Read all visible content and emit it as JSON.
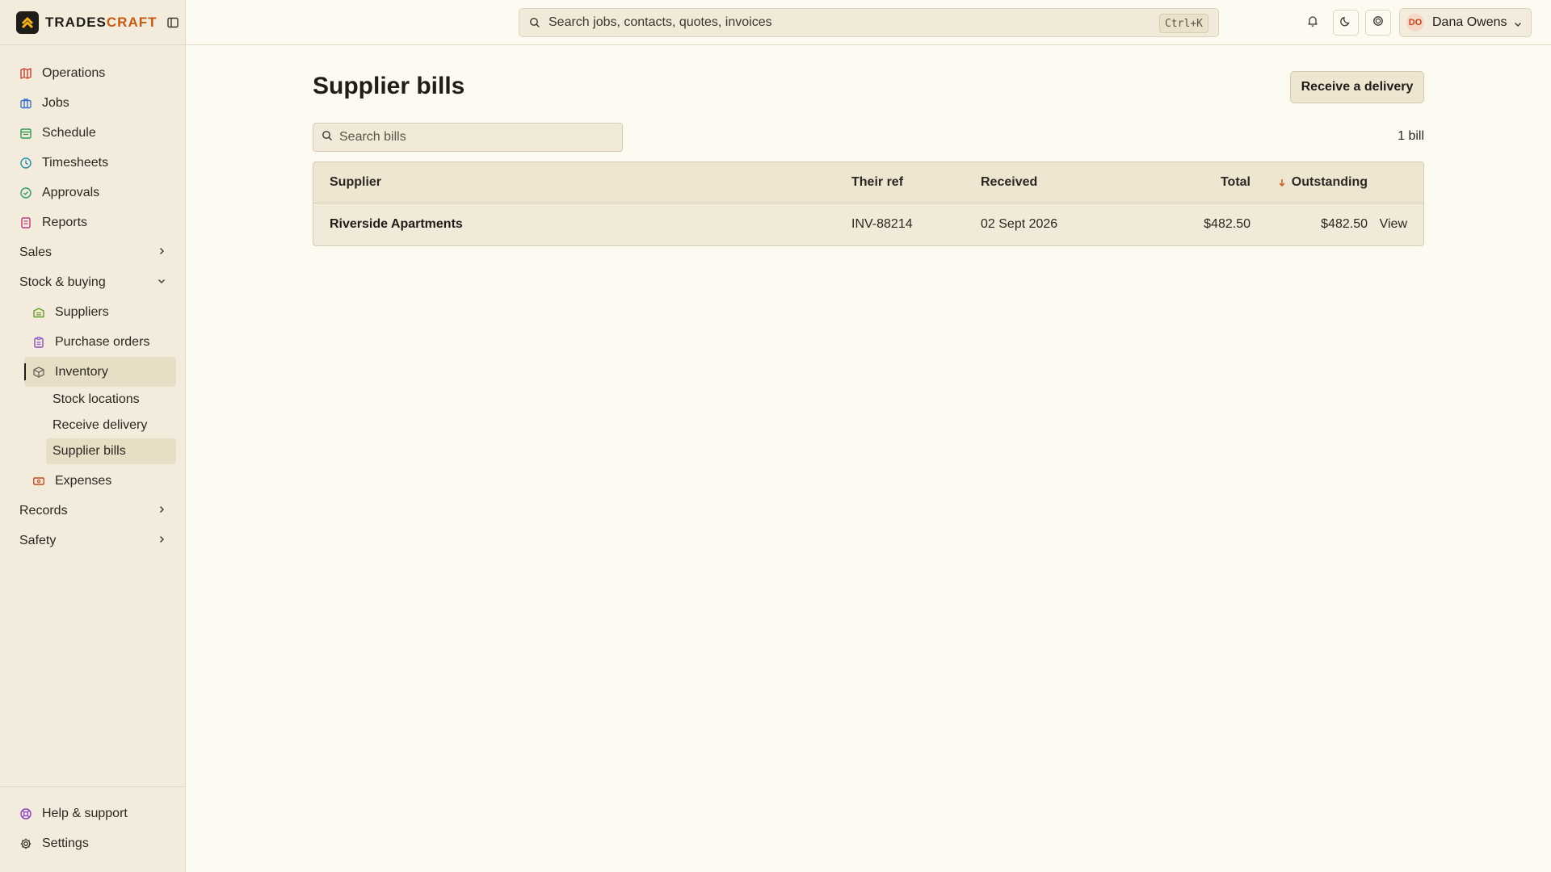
{
  "app": {
    "brand_prefix": "TRADES",
    "brand_suffix": "CRAFT"
  },
  "sidebar": {
    "items": [
      {
        "label": "Operations",
        "icon": "map-icon",
        "color": "#c8402c"
      },
      {
        "label": "Jobs",
        "icon": "briefcase-icon",
        "color": "#3a73c9"
      },
      {
        "label": "Schedule",
        "icon": "calendar-icon",
        "color": "#2f9a4c"
      },
      {
        "label": "Timesheets",
        "icon": "clock-icon",
        "color": "#1f8fa8"
      },
      {
        "label": "Approvals",
        "icon": "check-circle-icon",
        "color": "#2a9a6a"
      },
      {
        "label": "Reports",
        "icon": "report-icon",
        "color": "#c03a7a"
      }
    ],
    "groups": {
      "sales": "Sales",
      "stock": "Stock & buying",
      "records": "Records",
      "safety": "Safety"
    },
    "stock_items": [
      {
        "label": "Suppliers",
        "icon": "warehouse-icon",
        "color": "#6a9a2a"
      },
      {
        "label": "Purchase orders",
        "icon": "clipboard-icon",
        "color": "#8a4ac8"
      },
      {
        "label": "Inventory",
        "icon": "box-icon",
        "color": "#6b655a"
      }
    ],
    "inventory_sub": [
      "Stock locations",
      "Receive delivery",
      "Supplier bills"
    ],
    "expenses": {
      "label": "Expenses",
      "icon": "ticket-icon",
      "color": "#c44a22"
    },
    "bottom": [
      {
        "label": "Help & support",
        "icon": "lifebuoy-icon",
        "color": "#8a3ac0"
      },
      {
        "label": "Settings",
        "icon": "gear-icon",
        "color": "#3a362e"
      }
    ]
  },
  "topbar": {
    "search_placeholder": "Search jobs, contacts, quotes, invoices",
    "shortcut": "Ctrl+K",
    "user_initials": "DO",
    "user_name": "Dana Owens"
  },
  "main": {
    "title": "Supplier bills",
    "primary_action": "Receive a delivery",
    "search_placeholder": "Search bills",
    "count": "1 bill",
    "columns": {
      "supplier": "Supplier",
      "ref": "Their ref",
      "received": "Received",
      "total": "Total",
      "outstanding": "Outstanding"
    },
    "rows": [
      {
        "supplier": "Riverside Apartments",
        "ref": "INV-88214",
        "received": "02 Sept 2026",
        "total": "$482.50",
        "outstanding": "$482.50",
        "action": "View"
      }
    ]
  }
}
